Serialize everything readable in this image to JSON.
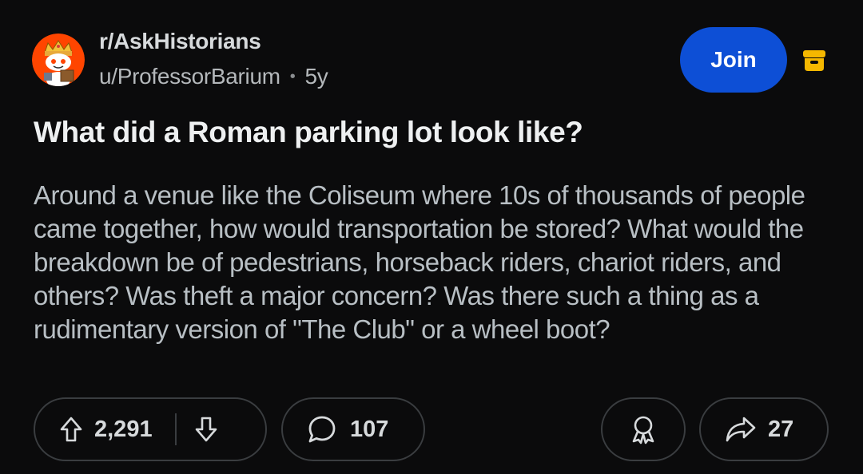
{
  "post": {
    "subreddit": "r/AskHistorians",
    "author": "u/ProfessorBarium",
    "separator": "•",
    "age": "5y",
    "join_label": "Join",
    "title": "What did a Roman parking lot look like?",
    "body": "Around a venue like the Coliseum where 10s of thousands of people came together, how would transportation be stored? What would the breakdown be of pedestrians, horseback riders, chariot riders, and others? Was theft a major concern? Was there such a thing as a rudimentary version of \"The Club\" or a wheel boot?"
  },
  "actions": {
    "upvote_icon": "arrow-up-icon",
    "score": "2,291",
    "downvote_icon": "arrow-down-icon",
    "comment_icon": "speech-bubble-icon",
    "comment_count": "107",
    "award_icon": "award-ribbon-icon",
    "share_icon": "share-arrow-icon",
    "share_count": "27"
  },
  "colors": {
    "background": "#0b0b0c",
    "join_button": "#0d4fd6",
    "archive_icon": "#f5b800",
    "pill_border": "#3a3d40"
  }
}
